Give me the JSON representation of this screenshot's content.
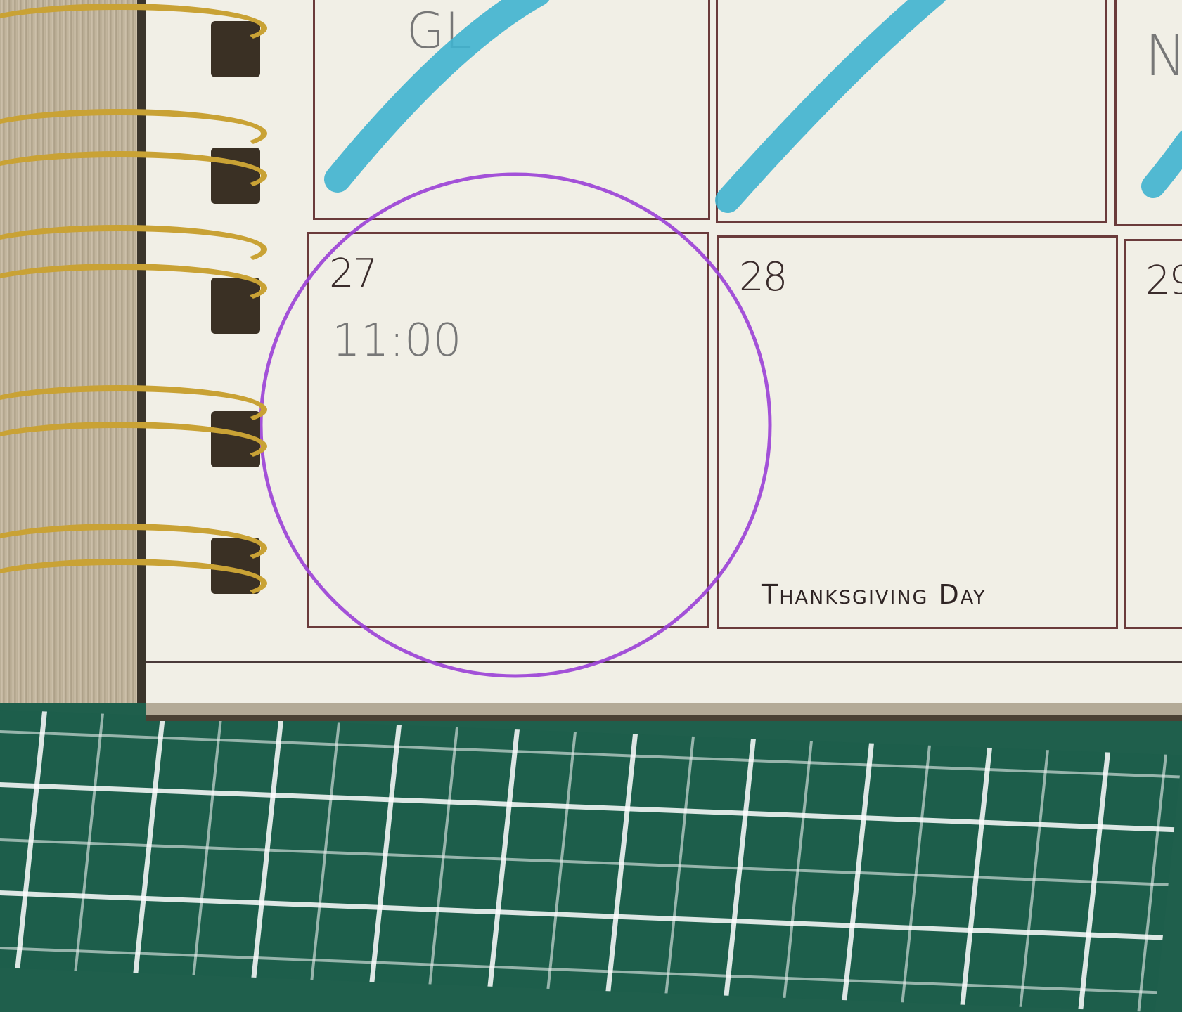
{
  "planner": {
    "days": [
      {
        "number": "27",
        "note": "11:00",
        "circled": true
      },
      {
        "number": "28",
        "holiday": "Thanksgiving Day"
      },
      {
        "number": "29"
      }
    ],
    "top_row_handwriting": [
      "GL",
      "N"
    ]
  },
  "colors": {
    "page": "#f1efe6",
    "grid_line": "#6b3b3b",
    "highlighter": "#3fb3cf",
    "circle": "#9a3fd6",
    "ring_metal": "#c9a235",
    "mat": "#1d5e4b"
  }
}
